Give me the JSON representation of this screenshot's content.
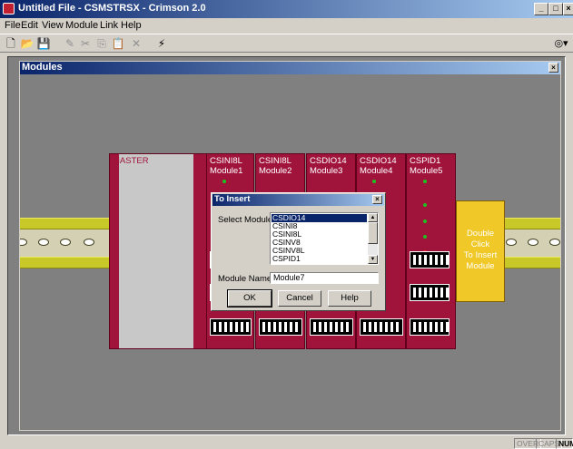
{
  "window": {
    "title": "Untitled File - CSMSTRSX - Crimson 2.0"
  },
  "menu": [
    {
      "label": "File"
    },
    {
      "label": "Edit"
    },
    {
      "label": "View"
    },
    {
      "label": "Module"
    },
    {
      "label": "Link"
    },
    {
      "label": "Help"
    }
  ],
  "toolbar": [
    {
      "name": "new-file-icon",
      "glyph": "🗋"
    },
    {
      "name": "open-folder-icon",
      "glyph": "📂"
    },
    {
      "name": "save-icon",
      "glyph": "💾"
    },
    {
      "name": "edit-pen-icon",
      "glyph": "✎"
    },
    {
      "name": "cut-icon",
      "glyph": "✂"
    },
    {
      "name": "copy-icon",
      "glyph": "⎘"
    },
    {
      "name": "paste-icon",
      "glyph": "📋"
    },
    {
      "name": "delete-icon",
      "glyph": "✕"
    },
    {
      "name": "link-bolt-icon",
      "glyph": "⚡"
    }
  ],
  "child": {
    "title": "Modules"
  },
  "rack": {
    "master_label": "MASTER",
    "modules": [
      {
        "type": "CSINI8L",
        "name": "Module1"
      },
      {
        "type": "CSINI8L",
        "name": "Module2"
      },
      {
        "type": "CSDIO14",
        "name": "Module3"
      },
      {
        "type": "CSDIO14",
        "name": "Module4"
      },
      {
        "type": "CSPID1",
        "name": "Module5"
      }
    ],
    "insert_text": [
      "Double",
      "Click",
      "To Insert",
      "Module"
    ]
  },
  "dialog": {
    "title": "To Insert",
    "select_label": "Select Module:",
    "options": [
      "CSDIO14",
      "CSINI8",
      "CSINI8L",
      "CSINV8",
      "CSINV8L",
      "CSPID1"
    ],
    "selected": "CSDIO14",
    "name_label": "Module Name:",
    "name_value": "Module7",
    "ok_label": "OK",
    "cancel_label": "Cancel",
    "help_label": "Help"
  },
  "status": {
    "over": "OVER",
    "caps": "CAPS",
    "num": "NUM"
  },
  "colors": {
    "module": "#a0143c",
    "rail": "#c8c828",
    "insert": "#f0c828",
    "titlebar": "#0a246a"
  }
}
